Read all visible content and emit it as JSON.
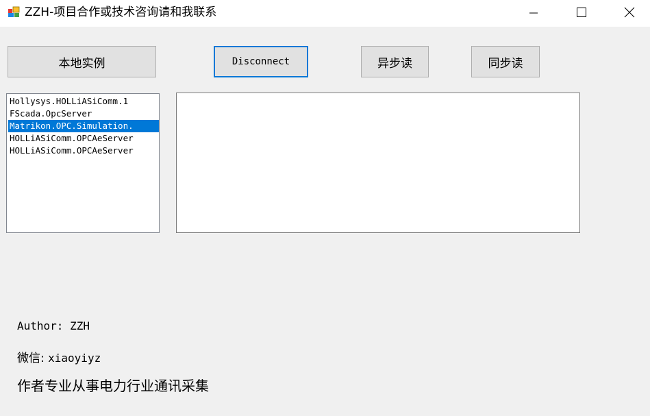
{
  "window": {
    "title": "ZZH-项目合作或技术咨询请和我联系"
  },
  "toolbar": {
    "local_instance_label": "本地实例",
    "disconnect_label": "Disconnect",
    "async_read_label": "异步读",
    "sync_read_label": "同步读"
  },
  "server_list": {
    "items": [
      "Hollysys.HOLLiASiComm.1",
      "FScada.OpcServer",
      "Matrikon.OPC.Simulation.",
      "HOLLiASiComm.OPCAeServer",
      "HOLLiASiComm.OPCAeServer"
    ],
    "selected_index": 2
  },
  "output": {
    "value": ""
  },
  "info": {
    "author": "Author: ZZH",
    "wechat_label": "微信: ",
    "wechat_value": "xiaoyiyz",
    "description": "作者专业从事电力行业通讯采集"
  },
  "colors": {
    "selection": "#0078d7",
    "focus_border": "#0078d7",
    "background": "#f0f0f0"
  }
}
